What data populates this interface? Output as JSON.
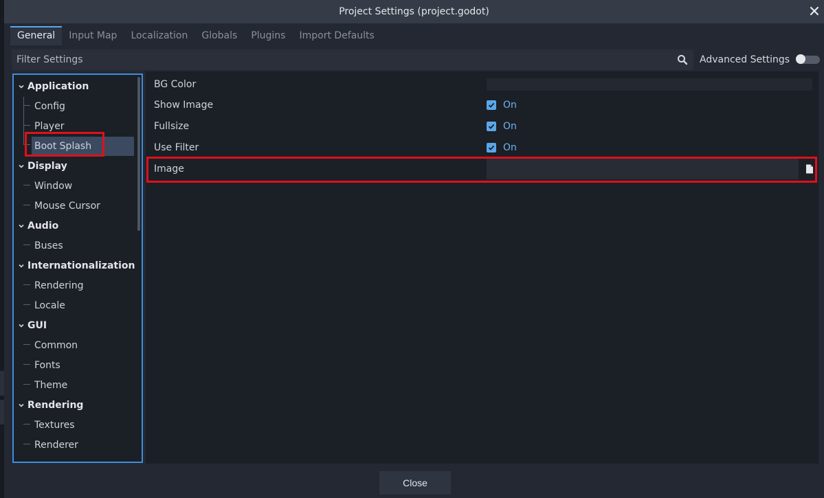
{
  "window": {
    "title": "Project Settings (project.godot)"
  },
  "tabs": [
    {
      "label": "General",
      "active": true
    },
    {
      "label": "Input Map",
      "active": false
    },
    {
      "label": "Localization",
      "active": false
    },
    {
      "label": "Globals",
      "active": false
    },
    {
      "label": "Plugins",
      "active": false
    },
    {
      "label": "Import Defaults",
      "active": false
    }
  ],
  "filter": {
    "placeholder": "Filter Settings"
  },
  "advanced": {
    "label": "Advanced Settings",
    "enabled": false
  },
  "tree": {
    "application": "Application",
    "config": "Config",
    "player": "Player",
    "boot_splash": "Boot Splash",
    "display": "Display",
    "window": "Window",
    "mouse_cursor": "Mouse Cursor",
    "audio": "Audio",
    "buses": "Buses",
    "internationalization": "Internationalization",
    "rendering_i18n": "Rendering",
    "locale": "Locale",
    "gui": "GUI",
    "common": "Common",
    "fonts": "Fonts",
    "theme": "Theme",
    "rendering": "Rendering",
    "textures": "Textures",
    "renderer": "Renderer",
    "selected": "Boot Splash"
  },
  "properties": {
    "bg_color": {
      "label": "BG Color",
      "color": "#232831"
    },
    "show_image": {
      "label": "Show Image",
      "value": "On",
      "checked": true
    },
    "fullsize": {
      "label": "Fullsize",
      "value": "On",
      "checked": true
    },
    "use_filter": {
      "label": "Use Filter",
      "value": "On",
      "checked": true
    },
    "image": {
      "label": "Image",
      "value": ""
    }
  },
  "footer": {
    "close_label": "Close"
  },
  "colors": {
    "accent": "#5aa7ea",
    "highlight": "#e0101a",
    "selection": "#3b4a60"
  }
}
